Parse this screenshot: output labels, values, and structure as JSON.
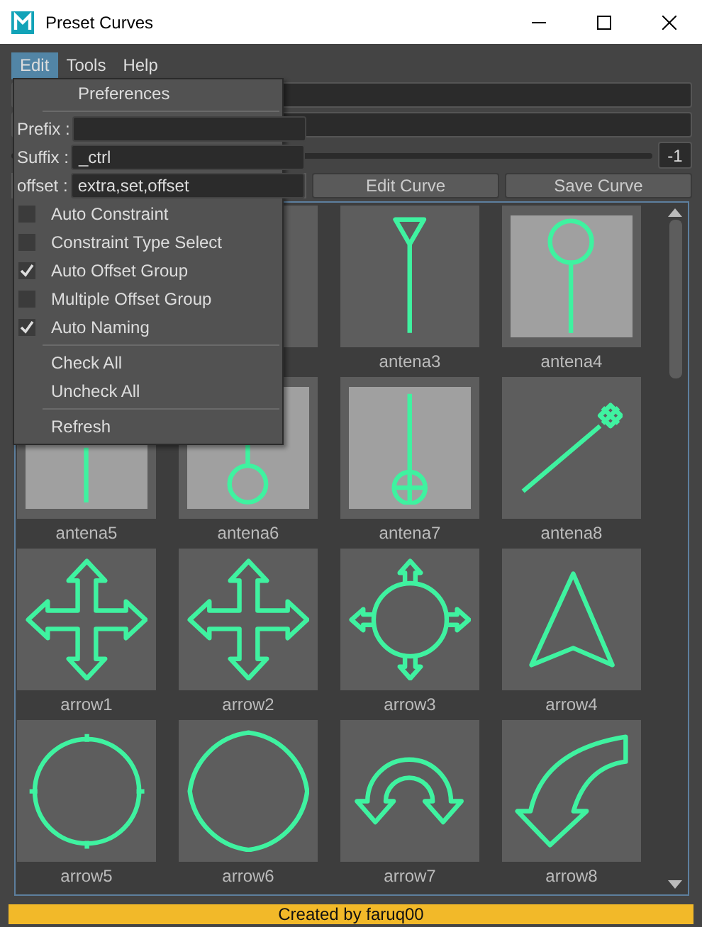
{
  "window": {
    "title": "Preset Curves"
  },
  "menu_bar": [
    {
      "label": "Edit",
      "selected": true
    },
    {
      "label": "Tools",
      "selected": false
    },
    {
      "label": "Help",
      "selected": false
    }
  ],
  "edit_menu": {
    "header": "Preferences",
    "fields": [
      {
        "label": "Prefix :"
      },
      {
        "label": "Suffix :",
        "value": "_ctrl"
      },
      {
        "label": "offset :",
        "value": "extra,set,offset"
      }
    ],
    "options": [
      {
        "label": "Auto Constraint",
        "checked": false
      },
      {
        "label": "Constraint Type Select",
        "checked": false
      },
      {
        "label": "Auto Offset Group",
        "checked": true
      },
      {
        "label": "Multiple Offset Group",
        "checked": false
      },
      {
        "label": "Auto Naming",
        "checked": true
      }
    ],
    "actions": [
      "Check All",
      "Uncheck All"
    ],
    "refresh": "Refresh"
  },
  "slider": {
    "reading": "-1"
  },
  "buttons": [
    "Edit Curve",
    "Save Curve"
  ],
  "cells": [
    {
      "kind": "hidden"
    },
    {
      "kind": "covered"
    },
    {
      "kind": "antenna-triangle",
      "shaded": false,
      "label": "antena3"
    },
    {
      "kind": "antenna-circle",
      "shaded": true,
      "label": "antena4"
    },
    {
      "kind": "antenna-line",
      "shaded": true,
      "label": "antena5"
    },
    {
      "kind": "antenna-ball",
      "shaded": true,
      "label": "antena6"
    },
    {
      "kind": "antenna-target",
      "shaded": true,
      "label": "antena7"
    },
    {
      "kind": "antenna-diagonal",
      "shaded": false,
      "label": "antena8"
    },
    {
      "kind": "cross-arrow",
      "shaded": false,
      "label": "arrow1"
    },
    {
      "kind": "cross-arrow",
      "shaded": false,
      "label": "arrow2"
    },
    {
      "kind": "ring-arrow",
      "shaded": false,
      "label": "arrow3"
    },
    {
      "kind": "pointer",
      "shaded": false,
      "label": "arrow4"
    },
    {
      "kind": "ring-ticks",
      "shaded": false,
      "label": "arrow5"
    },
    {
      "kind": "ring-cusps",
      "shaded": false,
      "label": "arrow6"
    },
    {
      "kind": "arch-arrow",
      "shaded": false,
      "label": "arrow7"
    },
    {
      "kind": "bend-arrow",
      "shaded": false,
      "label": "arrow8"
    }
  ],
  "status_bar": "Created by faruq00"
}
